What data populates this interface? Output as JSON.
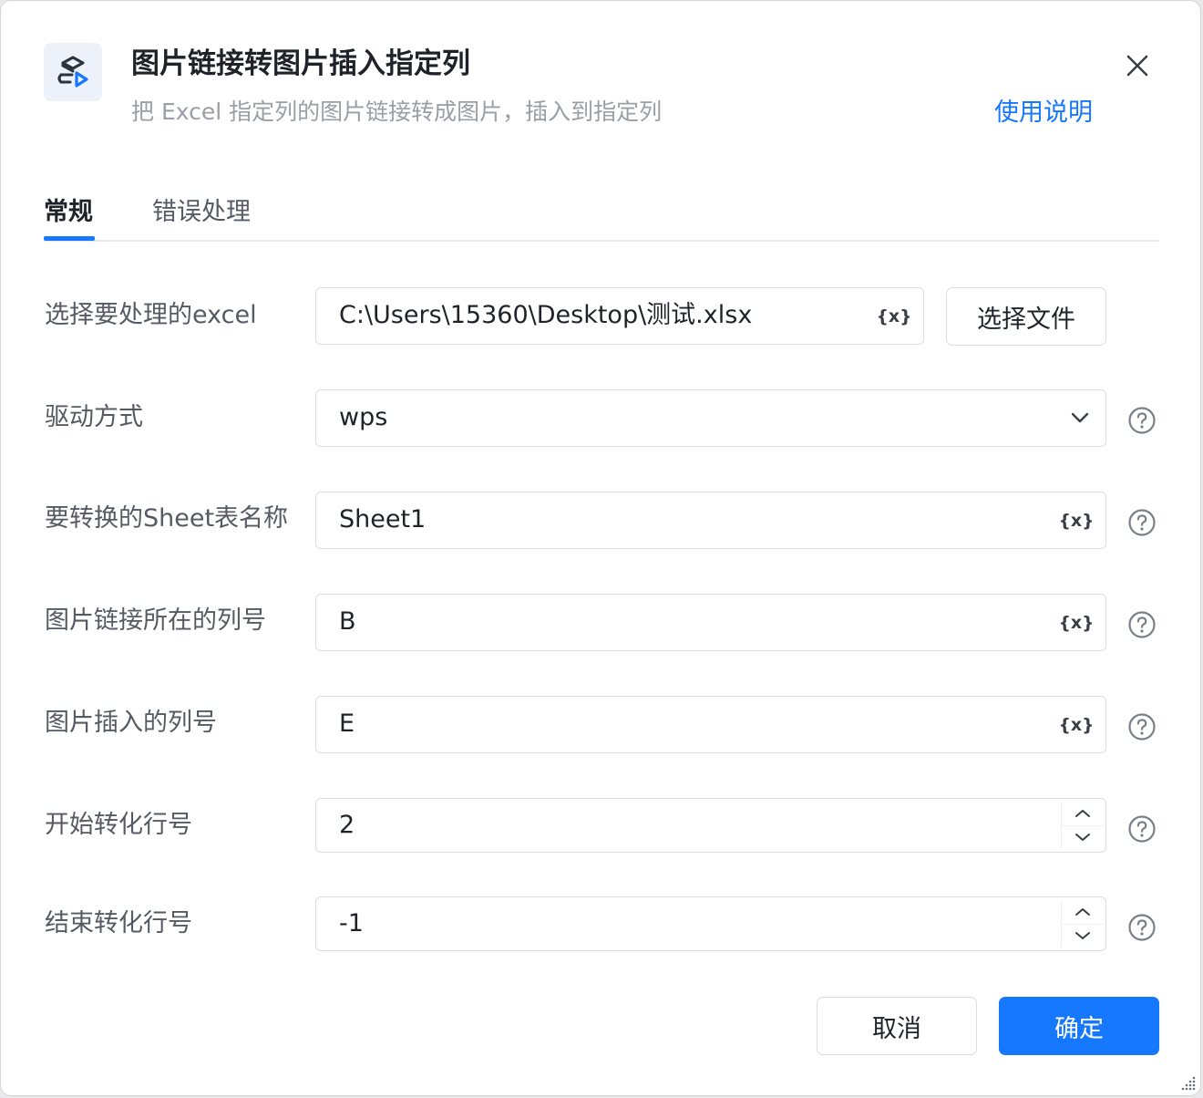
{
  "header": {
    "icon": "excel-image-insert-icon",
    "title": "图片链接转图片插入指定列",
    "subtitle": "把 Excel 指定列的图片链接转成图片，插入到指定列",
    "help_link": "使用说明",
    "close_icon": "close-icon"
  },
  "tabs": [
    {
      "label": "常规",
      "active": true
    },
    {
      "label": "错误处理",
      "active": false
    }
  ],
  "form": {
    "excel_file": {
      "label": "选择要处理的excel",
      "value": "C:\\Users\\15360\\Desktop\\测试.xlsx",
      "button_label": "选择文件",
      "variable_icon": "{x}"
    },
    "driver": {
      "label": "驱动方式",
      "value": "wps"
    },
    "sheet_name": {
      "label": "要转换的Sheet表名称",
      "value": "Sheet1",
      "variable_icon": "{x}"
    },
    "link_column": {
      "label": "图片链接所在的列号",
      "value": "B",
      "variable_icon": "{x}"
    },
    "insert_column": {
      "label": "图片插入的列号",
      "value": "E",
      "variable_icon": "{x}"
    },
    "start_row": {
      "label": "开始转化行号",
      "value": "2"
    },
    "end_row": {
      "label": "结束转化行号",
      "value": "-1"
    }
  },
  "footer": {
    "cancel_label": "取消",
    "ok_label": "确定"
  },
  "colors": {
    "accent": "#1677ff",
    "text_primary": "#1f2329",
    "text_secondary": "#555a63",
    "border": "#d9dce1"
  }
}
